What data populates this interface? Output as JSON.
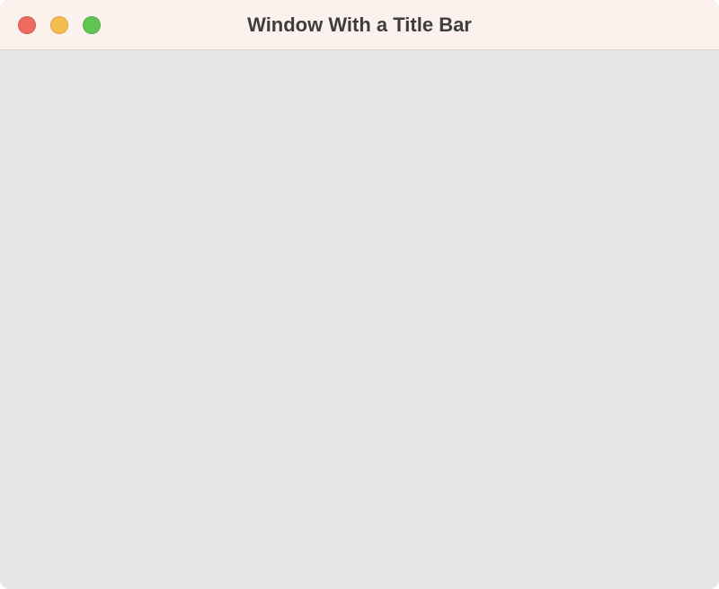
{
  "window": {
    "title": "Window With a Title Bar"
  }
}
